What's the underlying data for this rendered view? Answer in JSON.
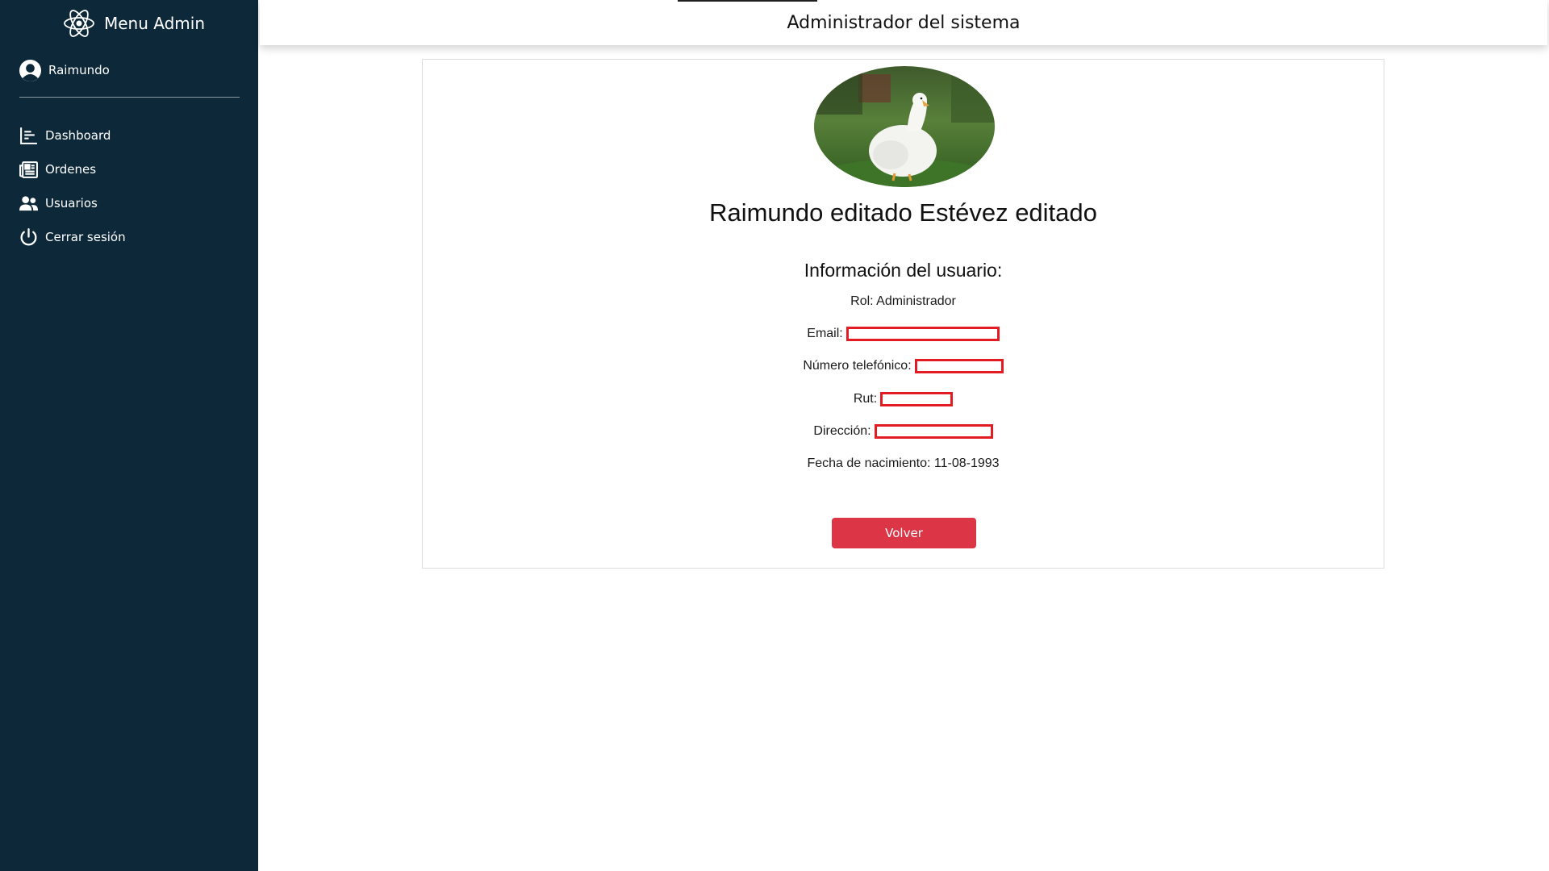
{
  "sidebar": {
    "brand_title": "Menu Admin",
    "brand_icon": "atom-react-icon",
    "user_name": "Raimundo",
    "nav": [
      {
        "label": "Dashboard",
        "icon": "chart-icon"
      },
      {
        "label": "Ordenes",
        "icon": "newspaper-icon"
      },
      {
        "label": "Usuarios",
        "icon": "users-icon"
      },
      {
        "label": "Cerrar sesión",
        "icon": "power-icon"
      }
    ],
    "bg_color": "#0d2838"
  },
  "header": {
    "title": "Administrador del sistema"
  },
  "profile": {
    "full_name": "Raimundo editado Estévez editado",
    "section_title": "Información del usuario:",
    "rol": "Rol: Administrador",
    "email_label": "Email:",
    "phone_label": "Número telefónico:",
    "rut_label": "Rut:",
    "address_label": "Dirección:",
    "birth": "Fecha de nacimiento: 11-08-1993"
  },
  "actions": {
    "back_label": "Volver",
    "back_color": "#dc3545"
  },
  "colors": {
    "redaction": "#e31b23"
  }
}
